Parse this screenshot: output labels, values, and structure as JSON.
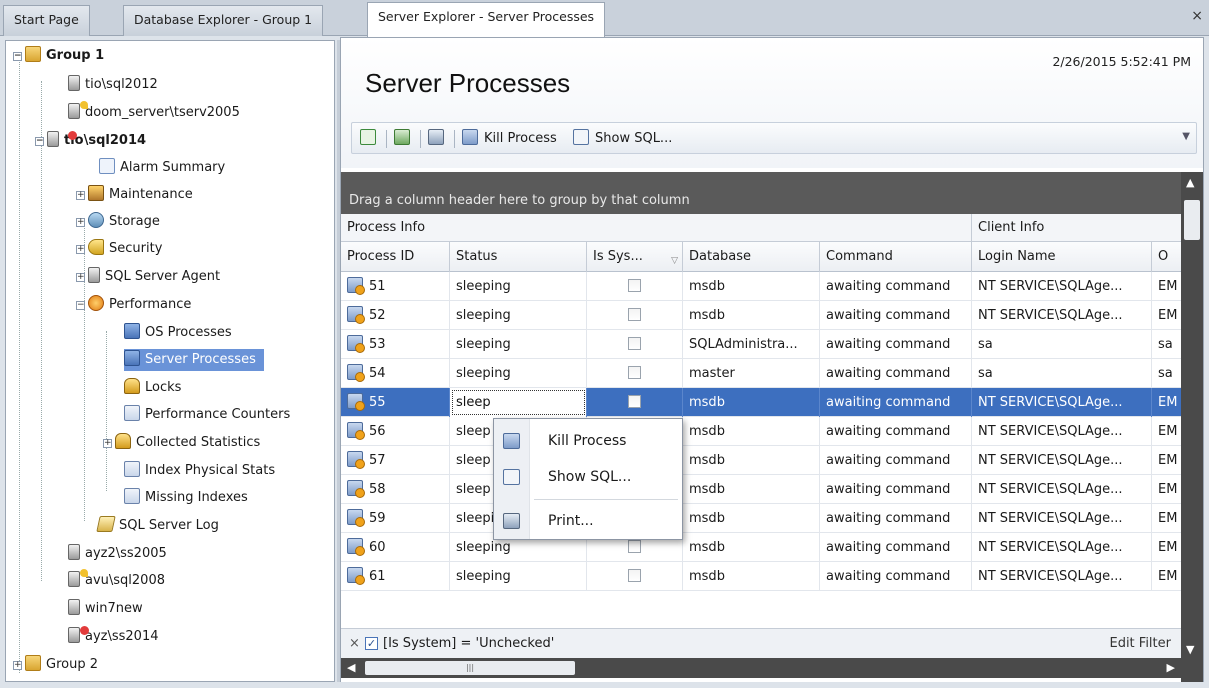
{
  "tabs": [
    {
      "label": "Start Page"
    },
    {
      "label": "Database Explorer - Group 1"
    },
    {
      "label": "Server Explorer - Server Processes"
    }
  ],
  "tabs_close": "×",
  "tree": {
    "group1": "Group 1",
    "tio2012": "tio\\sql2012",
    "doom": "doom_server\\tserv2005",
    "tio2014": "tio\\sql2014",
    "alarm": "Alarm Summary",
    "maintenance": "Maintenance",
    "storage": "Storage",
    "security": "Security",
    "agent": "SQL Server Agent",
    "performance": "Performance",
    "osproc": "OS Processes",
    "srvproc": "Server Processes",
    "locks": "Locks",
    "perfcounters": "Performance Counters",
    "collected": "Collected Statistics",
    "indexstats": "Index Physical Stats",
    "missing": "Missing Indexes",
    "sqllog": "SQL Server Log",
    "ayz2": "ayz2\\ss2005",
    "avu": "avu\\sql2008",
    "win7": "win7new",
    "ayz": "ayz\\ss2014",
    "group2": "Group 2"
  },
  "header": {
    "title": "Server Processes",
    "timestamp": "2/26/2015 5:52:41 PM"
  },
  "toolbar": {
    "kill_label": "Kill Process",
    "showsql_label": "Show SQL..."
  },
  "grid": {
    "group_hint": "Drag a column header here to group by that column",
    "bands": {
      "process": "Process Info",
      "client": "Client Info"
    },
    "columns": [
      "Process ID",
      "Status",
      "Is Sys...",
      "Database",
      "Command",
      "Login Name",
      "O"
    ],
    "rows": [
      {
        "pid": "51",
        "status": "sleeping",
        "db": "msdb",
        "cmd": "awaiting command",
        "login": "NT SERVICE\\SQLAge...",
        "o": "EM"
      },
      {
        "pid": "52",
        "status": "sleeping",
        "db": "msdb",
        "cmd": "awaiting command",
        "login": "NT SERVICE\\SQLAge...",
        "o": "EM"
      },
      {
        "pid": "53",
        "status": "sleeping",
        "db": "SQLAdministra...",
        "cmd": "awaiting command",
        "login": "sa",
        "o": "sa"
      },
      {
        "pid": "54",
        "status": "sleeping",
        "db": "master",
        "cmd": "awaiting command",
        "login": "sa",
        "o": "sa"
      },
      {
        "pid": "55",
        "status": "sleep",
        "db": "msdb",
        "cmd": "awaiting command",
        "login": "NT SERVICE\\SQLAge...",
        "o": "EM"
      },
      {
        "pid": "56",
        "status": "sleep",
        "db": "msdb",
        "cmd": "awaiting command",
        "login": "NT SERVICE\\SQLAge...",
        "o": "EM"
      },
      {
        "pid": "57",
        "status": "sleep",
        "db": "msdb",
        "cmd": "awaiting command",
        "login": "NT SERVICE\\SQLAge...",
        "o": "EM"
      },
      {
        "pid": "58",
        "status": "sleep",
        "db": "msdb",
        "cmd": "awaiting command",
        "login": "NT SERVICE\\SQLAge...",
        "o": "EM"
      },
      {
        "pid": "59",
        "status": "sleeping",
        "db": "msdb",
        "cmd": "awaiting command",
        "login": "NT SERVICE\\SQLAge...",
        "o": "EM"
      },
      {
        "pid": "60",
        "status": "sleeping",
        "db": "msdb",
        "cmd": "awaiting command",
        "login": "NT SERVICE\\SQLAge...",
        "o": "EM"
      },
      {
        "pid": "61",
        "status": "sleeping",
        "db": "msdb",
        "cmd": "awaiting command",
        "login": "NT SERVICE\\SQLAge...",
        "o": "EM"
      }
    ],
    "filter_text": "[Is System] = 'Unchecked'",
    "filter_close": "×",
    "edit_filter": "Edit Filter"
  },
  "context_menu": {
    "kill": "Kill Process",
    "showsql": "Show SQL...",
    "print": "Print..."
  },
  "colors": {
    "selection": "#3d6fbf",
    "tree_selection": "#6a93d8"
  }
}
